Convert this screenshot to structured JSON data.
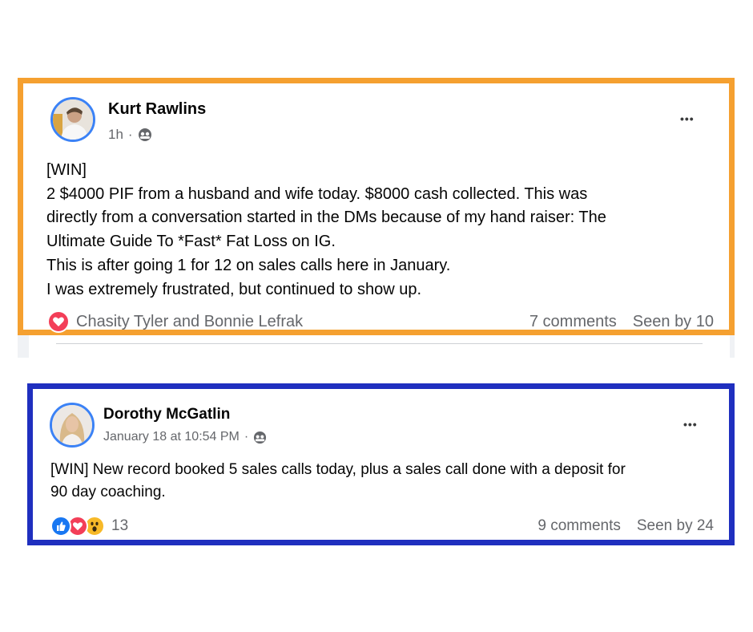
{
  "posts": [
    {
      "author": "Kurt Rawlins",
      "time": "1h",
      "separator": "·",
      "privacy_icon": "group-icon",
      "more_label": "•••",
      "lines": [
        "[WIN]",
        "2 $4000 PIF from a husband and wife today. $8000 cash collected. This was",
        "directly from a conversation started in the DMs because of my hand raiser: The",
        "Ultimate Guide To *Fast* Fat Loss on IG.",
        "This is after going 1 for 12 on sales calls here in January.",
        "I was extremely frustrated, but continued to show up."
      ],
      "reactions_text": "Chasity Tyler and Bonnie Lefrak",
      "reaction_icons": [
        "love-icon"
      ],
      "comments": "7 comments",
      "seen": "Seen by 10",
      "frame_color": "#f5a030"
    },
    {
      "author": "Dorothy McGatlin",
      "time": "January 18 at 10:54 PM",
      "separator": "·",
      "privacy_icon": "group-icon",
      "more_label": "•••",
      "lines": [
        "[WIN] New record booked 5 sales calls today, plus a sales call done with a deposit for",
        "90 day coaching."
      ],
      "reactions_text": "13",
      "reaction_icons": [
        "like-icon",
        "love-icon",
        "wow-icon"
      ],
      "comments": "9 comments",
      "seen": "Seen by 24",
      "frame_color": "#1f2fbf"
    }
  ]
}
